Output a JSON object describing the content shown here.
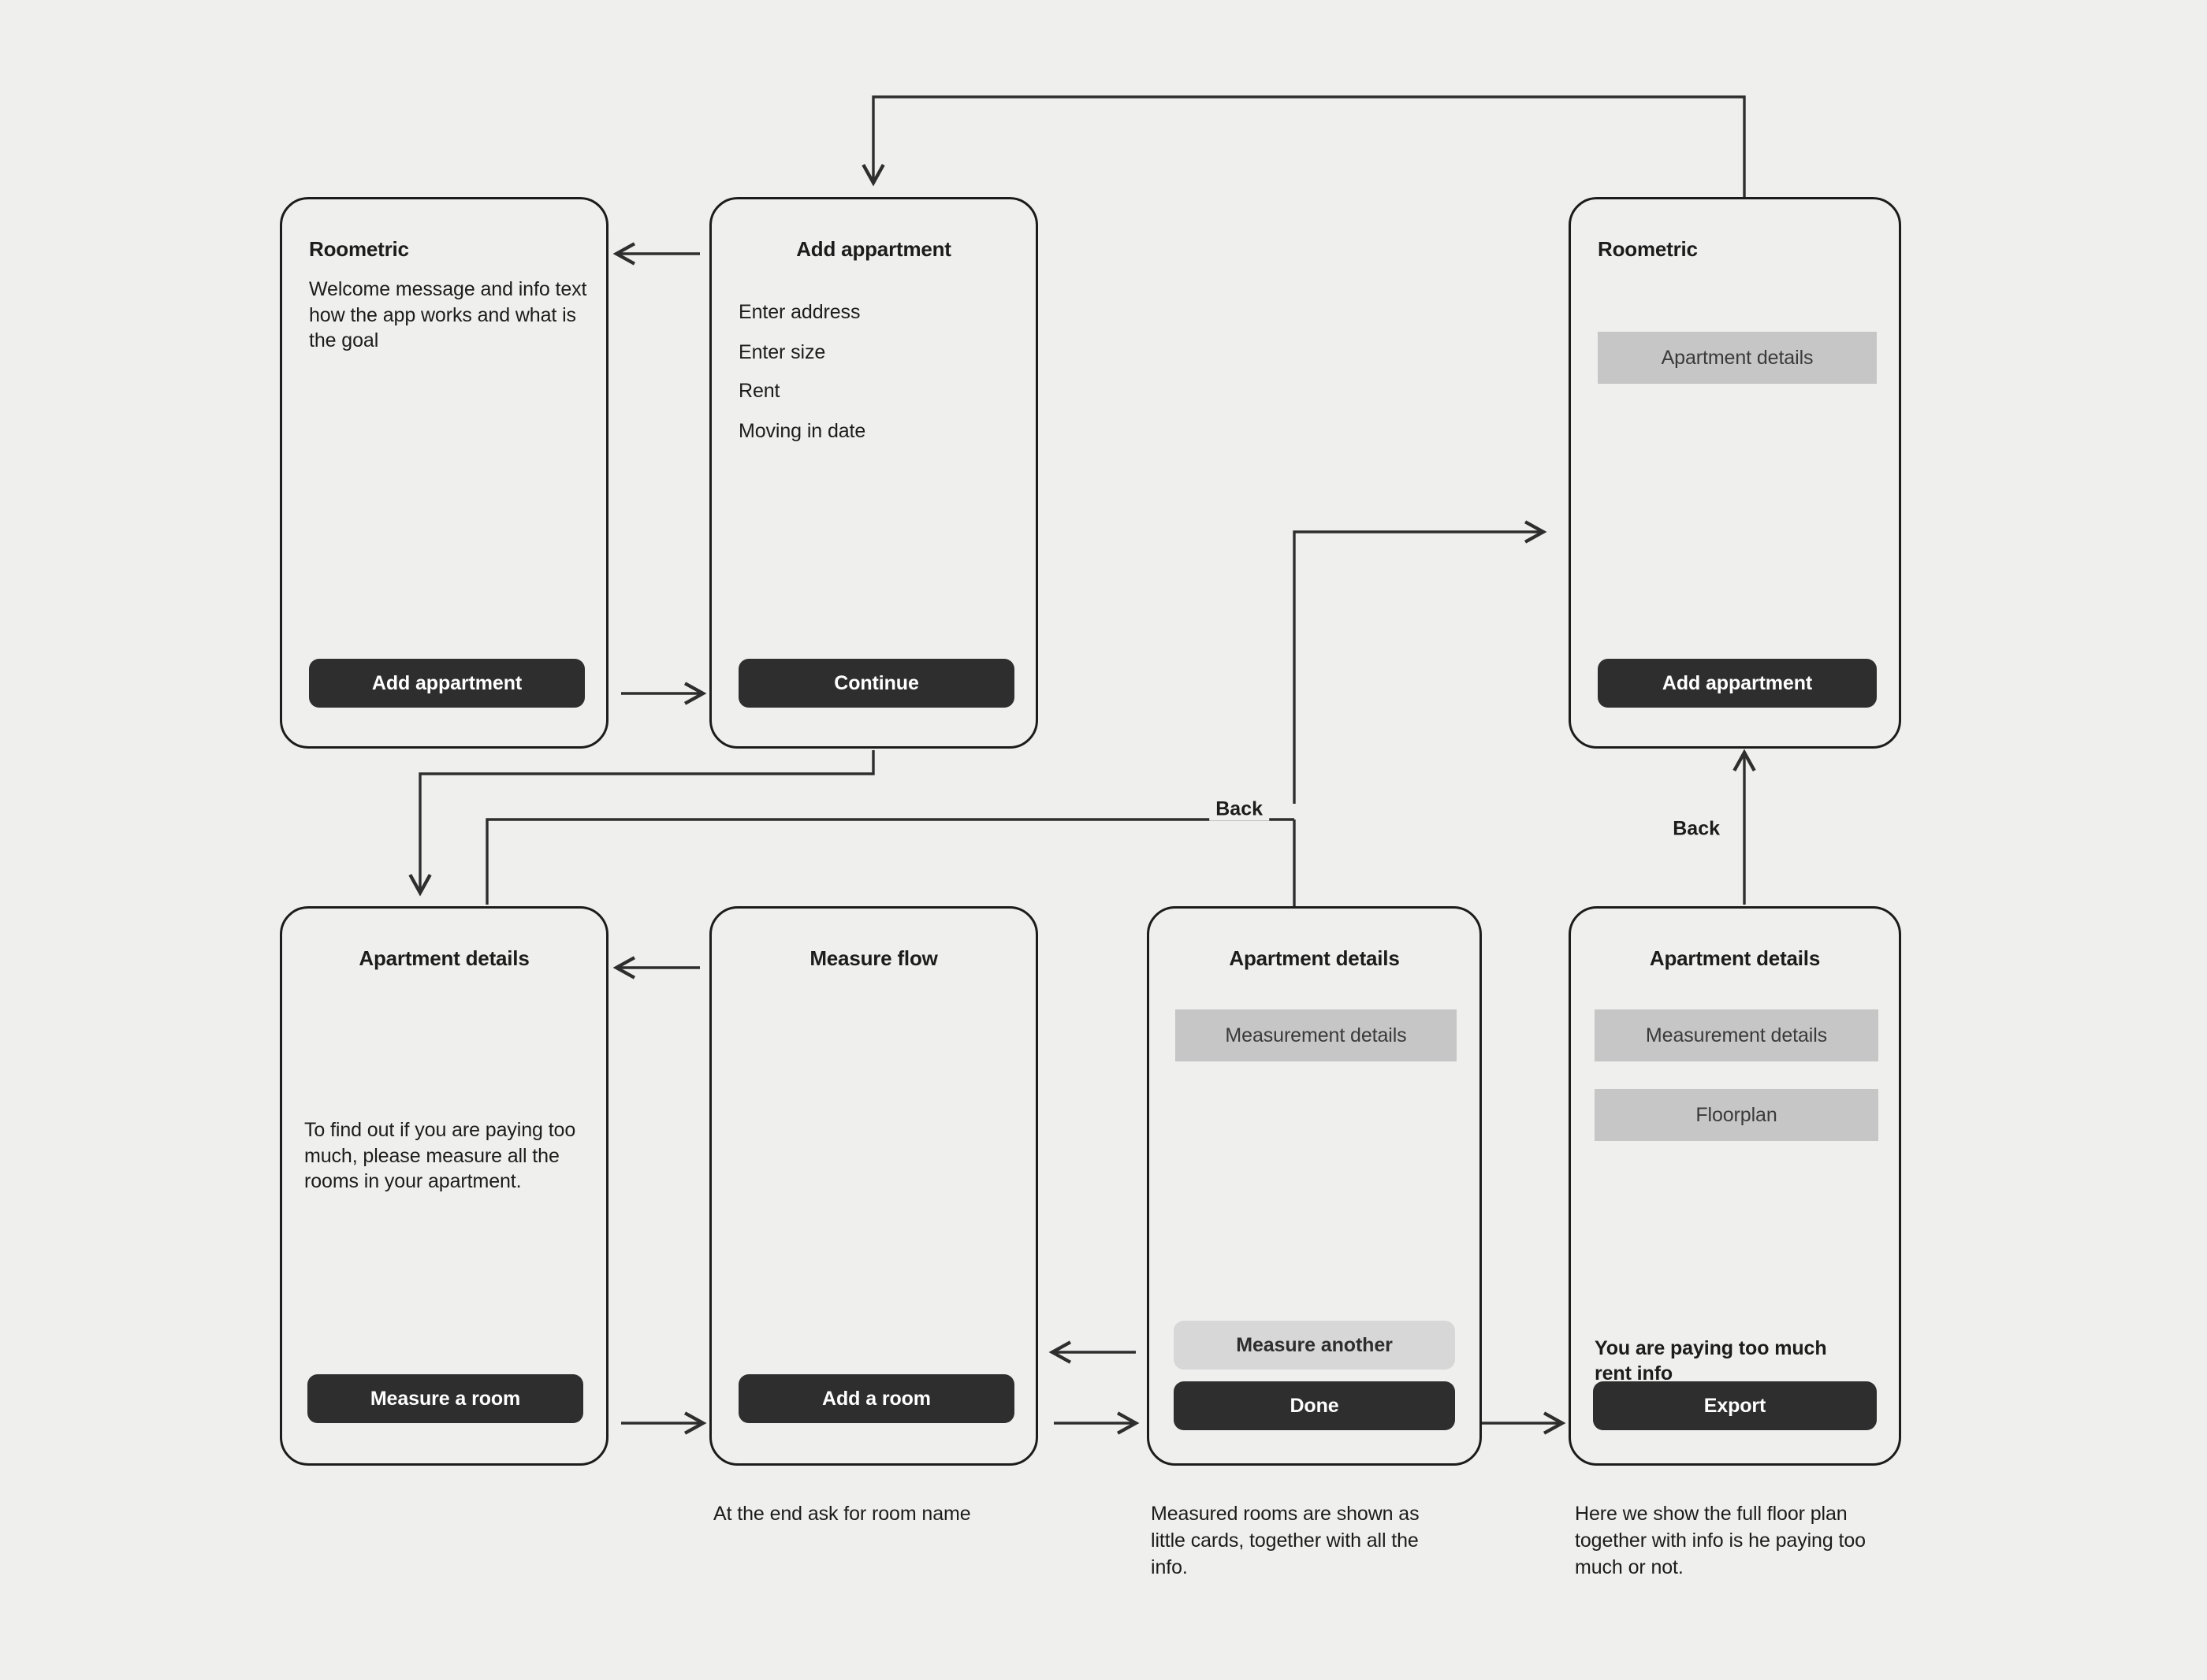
{
  "canvas": {
    "background": "#efefee",
    "line_color": "#2e2e2e",
    "accent_dark": "#2e2e2e",
    "placeholder_gray": "#c6c6c6",
    "light_button_gray": "#d7d7d7"
  },
  "screens": {
    "welcome": {
      "title": "Roometric",
      "body": "Welcome message and info text how the app works and what is the goal",
      "primary_button": "Add appartment"
    },
    "add_appartment": {
      "title": "Add appartment",
      "fields": [
        "Enter address",
        "Enter size",
        "Rent",
        "Moving in date"
      ],
      "primary_button": "Continue"
    },
    "home_with_apartment": {
      "title": "Roometric",
      "cards": [
        "Apartment details"
      ],
      "primary_button": "Add appartment"
    },
    "apartment_details_empty": {
      "title": "Apartment details",
      "body": "To find out if you are paying too much, please measure all the rooms in your apartment.",
      "primary_button": "Measure a room"
    },
    "measure_flow": {
      "title": "Measure flow",
      "primary_button": "Add a room",
      "caption": "At the end ask for room name"
    },
    "apartment_details_measured": {
      "title": "Apartment details",
      "cards": [
        "Measurement details"
      ],
      "secondary_button": "Measure another",
      "primary_button": "Done",
      "caption": "Measured rooms are shown as little cards, together with all the info."
    },
    "apartment_details_final": {
      "title": "Apartment details",
      "cards": [
        "Measurement details",
        "Floorplan"
      ],
      "note": "You are paying too much rent info",
      "primary_button": "Export",
      "caption": "Here we show the full floor plan together with info is he paying too much or not."
    }
  },
  "edges": {
    "back_left_label": "Back",
    "back_right_label": "Back"
  }
}
